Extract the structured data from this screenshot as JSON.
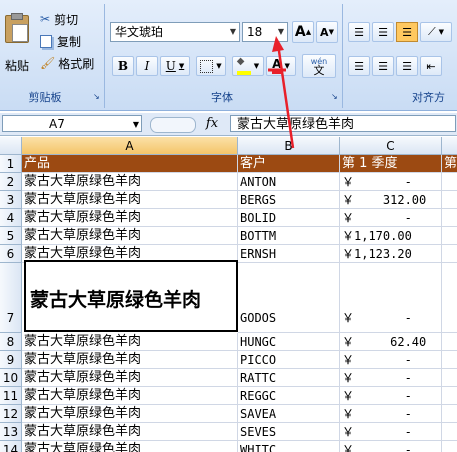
{
  "clipboard": {
    "paste": "粘贴",
    "cut": "剪切",
    "copy": "复制",
    "format_painter": "格式刷",
    "group": "剪贴板"
  },
  "font": {
    "name": "华文琥珀",
    "size": "18",
    "grow": "A",
    "shrink": "A",
    "bold": "B",
    "italic": "I",
    "underline": "U",
    "wen": "wén",
    "wen2": "文",
    "group": "字体"
  },
  "align": {
    "group": "对齐方"
  },
  "formula_bar": {
    "name_box": "A7",
    "fx": "fx",
    "content": "蒙古大草原绿色羊肉"
  },
  "columns": [
    {
      "label": "A"
    },
    {
      "label": "B"
    },
    {
      "label": "C"
    }
  ],
  "header_row": {
    "row": "1",
    "a": "产品",
    "b": "客户",
    "c": "第 1 季度",
    "d": "第"
  },
  "rows": [
    {
      "row": "2",
      "a": "蒙古大草原绿色羊肉",
      "b": "ANTON",
      "c": "￥       -"
    },
    {
      "row": "3",
      "a": "蒙古大草原绿色羊肉",
      "b": "BERGS",
      "c": "￥    312.00"
    },
    {
      "row": "4",
      "a": "蒙古大草原绿色羊肉",
      "b": "BOLID",
      "c": "￥       -"
    },
    {
      "row": "5",
      "a": "蒙古大草原绿色羊肉",
      "b": "BOTTM",
      "c": "￥1,170.00"
    },
    {
      "row": "6",
      "a": "蒙古大草原绿色羊肉",
      "b": "ERNSH",
      "c": "￥1,123.20"
    },
    {
      "row": "7",
      "a": "蒙古大草原绿色羊肉",
      "b": "GODOS",
      "c": "￥       -"
    },
    {
      "row": "8",
      "a": "蒙古大草原绿色羊肉",
      "b": "HUNGC",
      "c": "￥     62.40"
    },
    {
      "row": "9",
      "a": "蒙古大草原绿色羊肉",
      "b": "PICCO",
      "c": "￥       -"
    },
    {
      "row": "10",
      "a": "蒙古大草原绿色羊肉",
      "b": "RATTC",
      "c": "￥       -"
    },
    {
      "row": "11",
      "a": "蒙古大草原绿色羊肉",
      "b": "REGGC",
      "c": "￥       -"
    },
    {
      "row": "12",
      "a": "蒙古大草原绿色羊肉",
      "b": "SAVEA",
      "c": "￥       -"
    },
    {
      "row": "13",
      "a": "蒙古大草原绿色羊肉",
      "b": "SEVES",
      "c": "￥       -"
    },
    {
      "row": "14",
      "a": "蒙古大草原绿色羊肉",
      "b": "WHITC",
      "c": "￥       -"
    }
  ],
  "colors": {
    "header_fill": "#9c4a12",
    "annotation": "#e8202a"
  }
}
